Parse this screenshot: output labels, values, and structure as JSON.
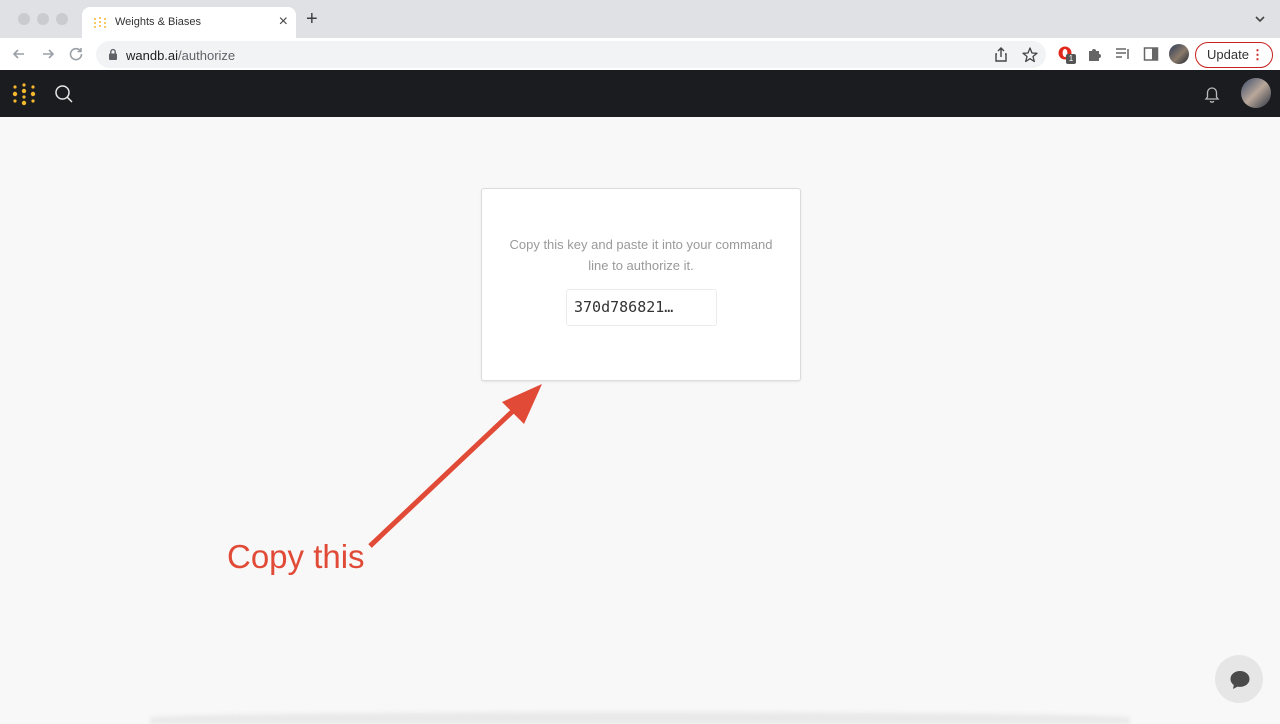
{
  "browser": {
    "tab_title": "Weights & Biases",
    "url_host": "wandb.ai",
    "url_path": "/authorize",
    "update_label": "Update",
    "extension_badge": "1"
  },
  "card": {
    "message": "Copy this key and paste it into your command line to authorize it.",
    "api_key": "370d786821…"
  },
  "annotation": {
    "text": "Copy this",
    "color": "#e04a36"
  },
  "colors": {
    "appbar": "#1a1c1f",
    "logo": "#f5b82e",
    "page_bg": "#f8f8f8"
  },
  "icons": [
    "wandb-logo-icon",
    "search-icon",
    "bell-icon",
    "avatar",
    "chat-icon",
    "lock-icon",
    "share-icon",
    "star-icon",
    "puzzle-icon",
    "reading-list-icon",
    "side-panel-icon"
  ]
}
